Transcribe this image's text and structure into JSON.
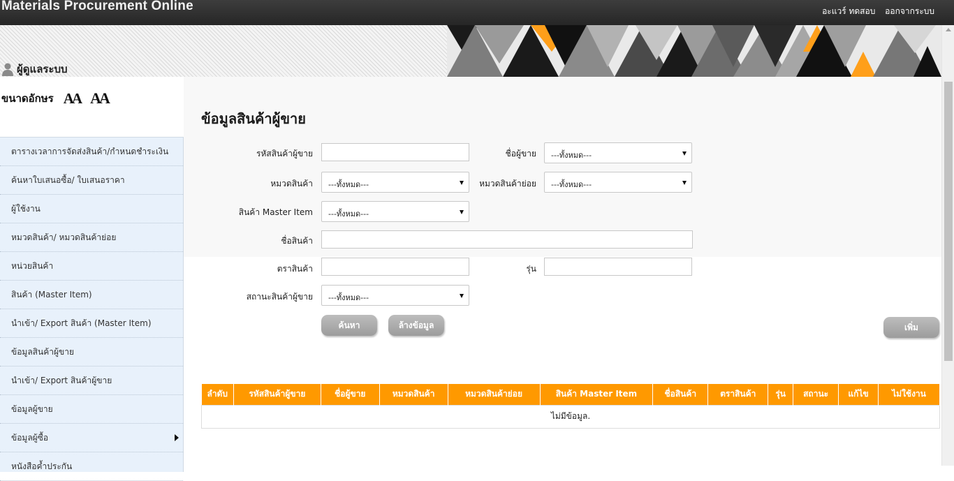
{
  "app": {
    "title": "Materials Procurement Online"
  },
  "topnav": {
    "user_name": "อะแวร์ ทดสอบ",
    "logout_label": "ออกจากระบบ"
  },
  "banner": {
    "role_label": "ผู้ดูแลระบบ"
  },
  "font_size": {
    "label": "ขนาดอักษร",
    "decrease_glyph": "AA",
    "increase_glyph": "AA"
  },
  "sidebar": {
    "items": [
      {
        "label": "ตารางเวลาการจัดส่งสินค้า/กำหนดชำระเงิน"
      },
      {
        "label": "ค้นหาใบเสนอซื้อ/ ใบเสนอราคา"
      },
      {
        "label": "ผู้ใช้งาน"
      },
      {
        "label": "หมวดสินค้า/ หมวดสินค้าย่อย"
      },
      {
        "label": "หน่วยสินค้า"
      },
      {
        "label": "สินค้า (Master Item)"
      },
      {
        "label": "นำเข้า/ Export สินค้า (Master Item)"
      },
      {
        "label": "ข้อมูลสินค้าผู้ขาย"
      },
      {
        "label": "นำเข้า/ Export สินค้าผู้ขาย"
      },
      {
        "label": "ข้อมูลผู้ขาย"
      },
      {
        "label": "ข้อมูลผู้ซื้อ"
      },
      {
        "label": "หนังสือค้ำประกัน"
      }
    ]
  },
  "main": {
    "title": "ข้อมูลสินค้าผู้ขาย"
  },
  "search": {
    "vendor_product_code_label": "รหัสสินค้าผู้ขาย",
    "vendor_product_code_value": "",
    "vendor_name_label": "ชื่อผู้ขาย",
    "vendor_name_value": "---ทั้งหมด---",
    "category_label": "หมวดสินค้า",
    "category_value": "---ทั้งหมด---",
    "subcategory_label": "หมวดสินค้าย่อย",
    "subcategory_value": "---ทั้งหมด---",
    "master_item_label": "สินค้า Master Item",
    "master_item_value": "---ทั้งหมด---",
    "product_name_label": "ชื่อสินค้า",
    "product_name_value": "",
    "brand_label": "ตราสินค้า",
    "brand_value": "",
    "model_label": "รุ่น",
    "model_value": "",
    "status_label": "สถานะสินค้าผู้ขาย",
    "status_value": "---ทั้งหมด---",
    "search_button": "ค้นหา",
    "clear_button": "ล้างข้อมูล",
    "add_button": "เพิ่ม"
  },
  "results": {
    "columns": [
      "ลำดับ",
      "รหัสสินค้าผู้ขาย",
      "ชื่อผู้ขาย",
      "หมวดสินค้า",
      "หมวดสินค้าย่อย",
      "สินค้า Master Item",
      "ชื่อสินค้า",
      "ตราสินค้า",
      "รุ่น",
      "สถานะ",
      "แก้ไข",
      "ไม่ใช้งาน"
    ],
    "empty_message": "ไม่มีข้อมูล."
  },
  "colors": {
    "header_bar": "#2e2e2e",
    "accent_orange": "#ff9900",
    "sidebar_bg": "#e8f1fb",
    "button_gray": "#aaaaaa"
  },
  "icons": {
    "user": "person-icon",
    "submenu": "caret-right-icon",
    "select": "dropdown-arrow-icon"
  }
}
